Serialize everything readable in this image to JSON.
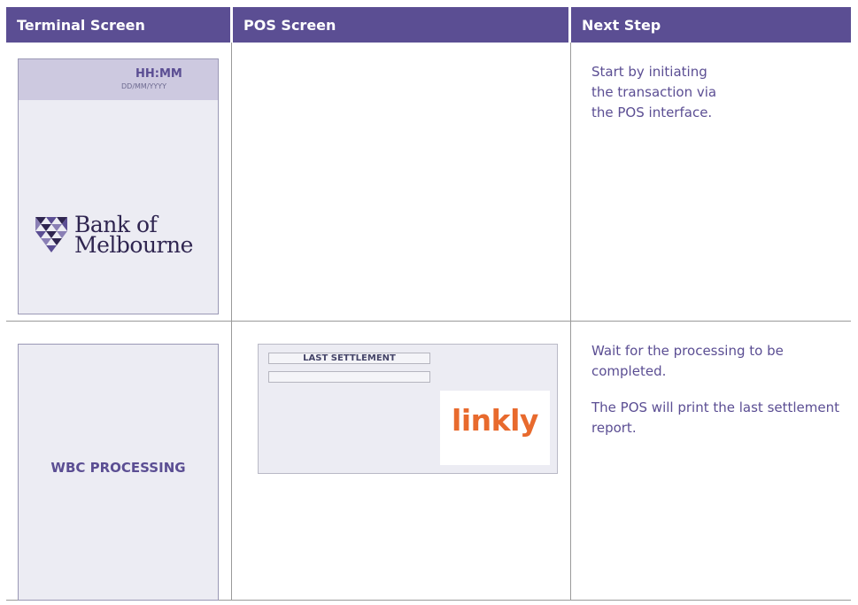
{
  "headers": {
    "terminal": "Terminal Screen",
    "pos": "POS Screen",
    "next_step": "Next Step"
  },
  "row1": {
    "terminal": {
      "time": "HH:MM",
      "date": "DD/MM/YYYY",
      "logo_line1": "Bank of",
      "logo_line2": "Melbourne"
    },
    "next_step": {
      "line1": "Start by initiating",
      "line2": "the transaction via",
      "line3": "the POS interface."
    }
  },
  "row2": {
    "terminal": {
      "status": "WBC PROCESSING"
    },
    "pos": {
      "field_label": "LAST SETTLEMENT",
      "brand": "linkly"
    },
    "next_step": {
      "para1": "Wait for the processing to be completed.",
      "para2": "The POS will print the last settlement report."
    }
  },
  "colors": {
    "header_bg": "#5b4e93",
    "accent_text": "#5b4e93",
    "linkly": "#e86a2d",
    "logo": "#2f2550"
  }
}
